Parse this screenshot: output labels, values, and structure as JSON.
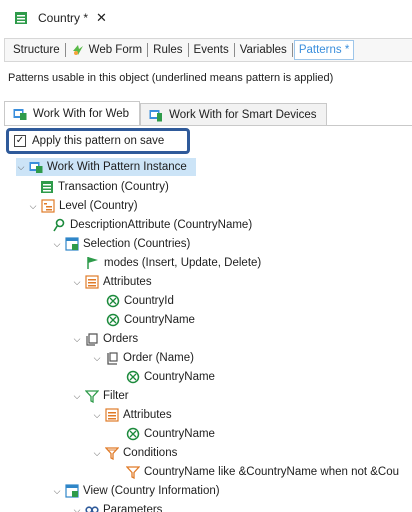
{
  "doc_tab": {
    "title": "Country *",
    "close": "✕"
  },
  "subtabs": [
    "Structure",
    "Web Form",
    "Rules",
    "Events",
    "Variables",
    "Patterns *"
  ],
  "description": "Patterns usable in this object (underlined means pattern is applied)",
  "pattern_tabs": [
    "Work With for Web",
    "Work With for Smart Devices"
  ],
  "apply": {
    "label": "Apply this pattern on save",
    "checked": "✓"
  },
  "tree": [
    "Work With Pattern Instance",
    "Transaction (Country)",
    "Level (Country)",
    "DescriptionAttribute (CountryName)",
    "Selection (Countries)",
    "modes (Insert, Update, Delete)",
    "Attributes",
    "CountryId",
    "CountryName",
    "Orders",
    "Order (Name)",
    "CountryName",
    "Filter",
    "Attributes",
    "CountryName",
    "Conditions",
    "CountryName like &CountryName when not &Cou",
    "View (Country Information)",
    "Parameters"
  ],
  "colors": {
    "accent": "#3a8edc",
    "highlight_border": "#2f5a9a",
    "selection": "#cce4f7"
  }
}
